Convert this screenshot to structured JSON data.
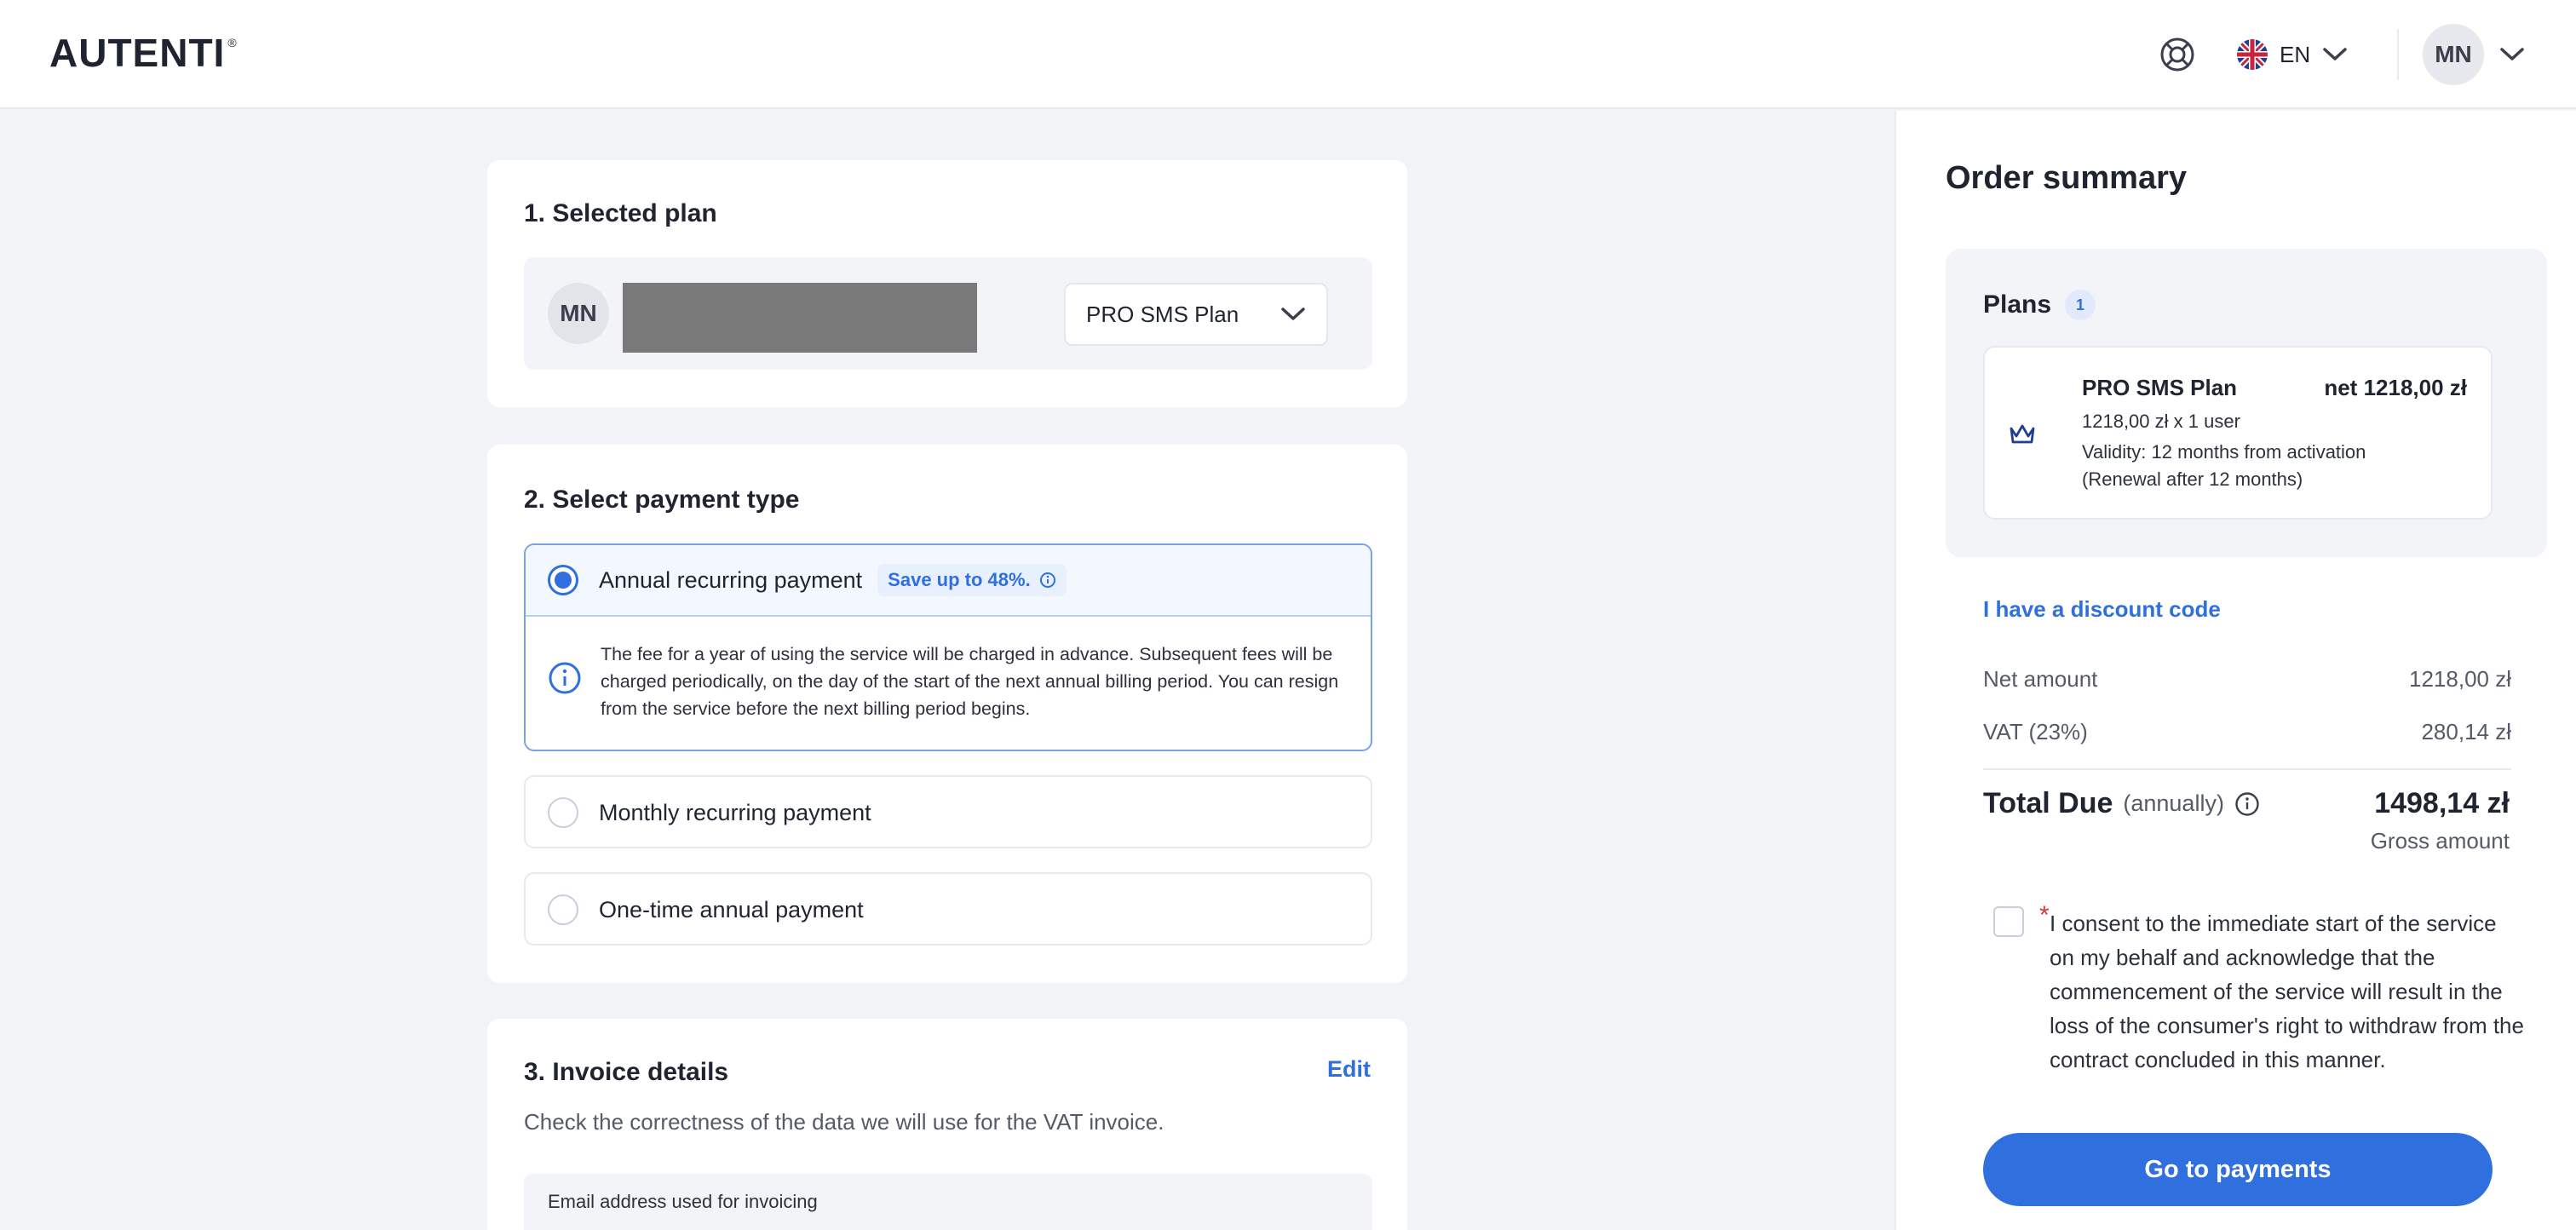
{
  "header": {
    "logo_text": "AUTENTI",
    "logo_reg": "®",
    "language": "EN",
    "user_initials": "MN"
  },
  "section_plan": {
    "title": "1. Selected plan",
    "user_initials": "MN",
    "selected_plan": "PRO SMS Plan"
  },
  "section_payment": {
    "title": "2. Select payment type",
    "options": [
      {
        "label": "Annual recurring payment",
        "badge": "Save up to 48%.",
        "selected": true,
        "info": "The fee for a year of using the service will be charged in advance. Subsequent fees will be charged periodically, on the day of the start of the next annual billing period. You can resign from the service before the next billing period begins."
      },
      {
        "label": "Monthly recurring payment",
        "selected": false
      },
      {
        "label": "One-time annual payment",
        "selected": false
      }
    ]
  },
  "section_invoice": {
    "title": "3. Invoice details",
    "edit_label": "Edit",
    "subtitle": "Check the correctness of the data we will use for the VAT invoice.",
    "email_label": "Email address used for invoicing"
  },
  "summary": {
    "title": "Order summary",
    "plans_label": "Plans",
    "plans_count": "1",
    "plan": {
      "name": "PRO SMS Plan",
      "price": "net 1218,00 zł",
      "unit_line": "1218,00 zł x 1 user",
      "validity": "Validity: 12 months from activation",
      "renewal": "(Renewal after 12 months)"
    },
    "discount_link": "I have a discount code",
    "net_label": "Net amount",
    "net_value": "1218,00 zł",
    "vat_label": "VAT (23%)",
    "vat_value": "280,14 zł",
    "total_label": "Total Due",
    "total_period": "(annually)",
    "total_value": "1498,14 zł",
    "gross_label": "Gross amount",
    "consent_required": "*",
    "consent_text": "I consent to the immediate start of the service on my behalf and acknowledge that the commencement of the service will result in the loss of the consumer's right to withdraw from the contract concluded in this manner.",
    "cta": "Go to payments"
  },
  "colors": {
    "accent": "#2f6fde",
    "required": "#d93a3a",
    "page_bg": "#f1f3f7"
  }
}
